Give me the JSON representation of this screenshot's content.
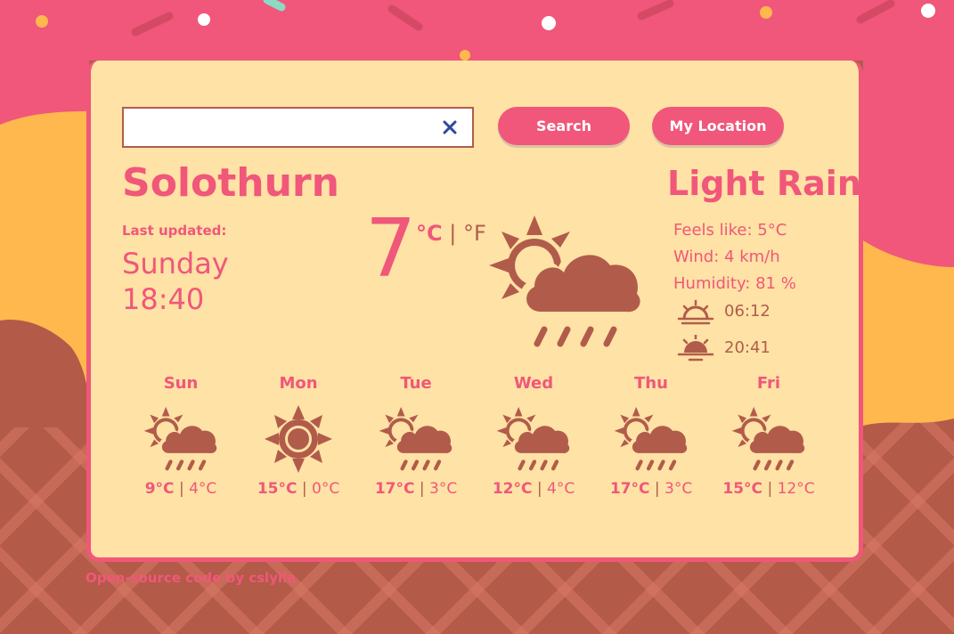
{
  "search": {
    "value": "",
    "placeholder": "",
    "search_label": "Search",
    "location_label": "My Location"
  },
  "current": {
    "city": "Solothurn",
    "last_updated_label": "Last updated:",
    "day": "Sunday",
    "time": "18:40",
    "temperature": "7",
    "unit_c": "°C",
    "unit_sep": "|",
    "unit_f": "°F",
    "condition": "Light Rain",
    "feels_like": "Feels like: 5°C",
    "wind": "Wind: 4 km/h",
    "humidity": "Humidity: 81 %",
    "sunrise": "06:12",
    "sunset": "20:41"
  },
  "forecast": [
    {
      "day": "Sun",
      "high": "9°C",
      "low": "4°C",
      "icon": "sun-cloud-rain-icon"
    },
    {
      "day": "Mon",
      "high": "15°C",
      "low": "0°C",
      "icon": "sun-icon"
    },
    {
      "day": "Tue",
      "high": "17°C",
      "low": "3°C",
      "icon": "sun-cloud-rain-icon"
    },
    {
      "day": "Wed",
      "high": "12°C",
      "low": "4°C",
      "icon": "sun-cloud-rain-icon"
    },
    {
      "day": "Thu",
      "high": "17°C",
      "low": "3°C",
      "icon": "sun-cloud-rain-icon"
    },
    {
      "day": "Fri",
      "high": "15°C",
      "low": "12°C",
      "icon": "sun-cloud-rain-icon"
    }
  ],
  "footer": {
    "credit": "Open-source code by cslylla"
  },
  "colors": {
    "accent": "#f0577a",
    "brown": "#b15c4b",
    "card": "#ffe2a5",
    "caramel": "#ffb84d"
  }
}
